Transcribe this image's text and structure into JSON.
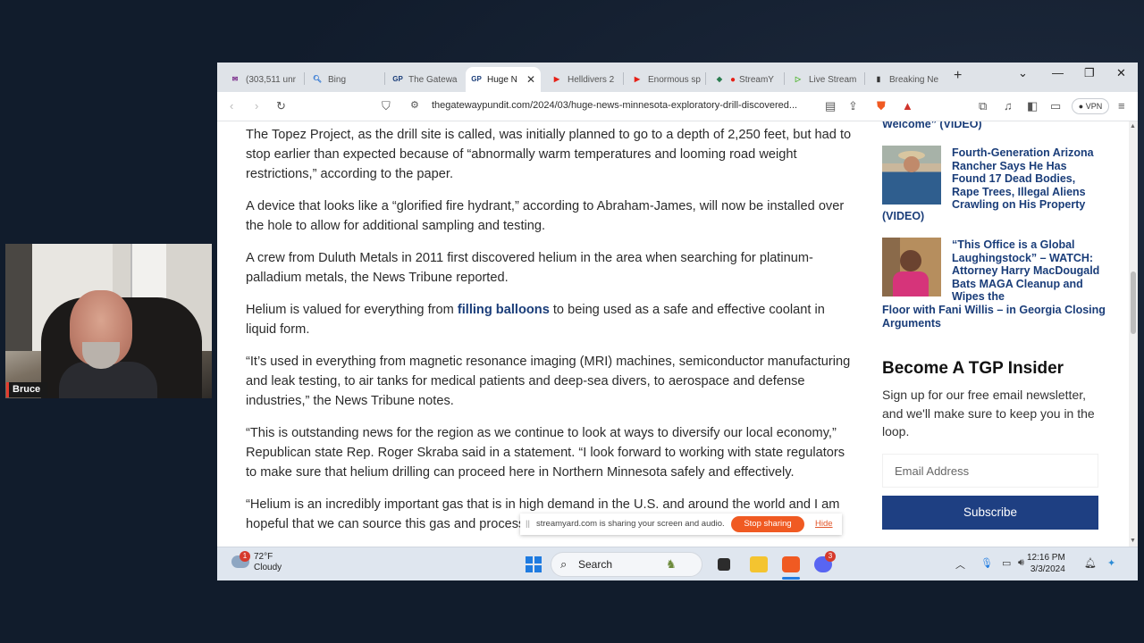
{
  "webcam": {
    "name": "Bruce"
  },
  "tabs": [
    {
      "label": "(303,511 unr",
      "icon": "mail-icon",
      "color": "#7b2d8b"
    },
    {
      "label": "Bing",
      "icon": "search-icon",
      "color": "#1b6ad1"
    },
    {
      "label": "The Gatewa",
      "icon": "gp-icon",
      "color": "#1a3d79"
    },
    {
      "label": "Huge N",
      "icon": "gp-icon",
      "color": "#1a3d79",
      "active": true
    },
    {
      "label": "Helldivers 2",
      "icon": "youtube-icon",
      "color": "#e62117"
    },
    {
      "label": "Enormous sp",
      "icon": "youtube-icon",
      "color": "#e62117"
    },
    {
      "label": "StreamY",
      "icon": "streamyard-icon",
      "color": "#2a7d4f"
    },
    {
      "label": "Live Stream",
      "icon": "rumble-icon",
      "color": "#4cb32a"
    },
    {
      "label": "Breaking Ne",
      "icon": "bookmark-icon",
      "color": "#333333"
    }
  ],
  "address": {
    "url": "thegatewaypundit.com/2024/03/huge-news-minnesota-exploratory-drill-discovered..."
  },
  "toolbar": {
    "vpn_label": "VPN"
  },
  "article": {
    "paragraphs": [
      "The Topez Project, as the drill site is called, was initially planned to go to a depth of 2,250 feet, but had to stop earlier than expected because of “abnormally warm temperatures and looming road weight restrictions,” according to the paper.",
      "A device that looks like a “glorified fire hydrant,” according to Abraham-James, will now be installed over the hole to allow for additional sampling and testing.",
      "A crew from Duluth Metals in 2011 first discovered helium in the area when searching for platinum-palladium metals, the News Tribune reported."
    ],
    "p4_before": "Helium is valued for everything from ",
    "p4_link": "filling balloons",
    "p4_after": " to being used as a safe and effective coolant in liquid form.",
    "p5": "“It’s used in everything from magnetic resonance imaging (MRI) machines, semiconductor manufacturing and leak testing, to air tanks for medical patients and deep-sea divers, to aerospace and defense industries,” the News Tribune notes.",
    "p6": "“This is outstanding news for the region as we continue to look at ways to diversify our local economy,” Republican state Rep. Roger Skraba said in a statement. “I look forward to working with state regulators to make sure that helium drilling can proceed here in Northern Minnesota safely and effectively.",
    "p7": "“Helium is an incredibly important gas that is in high demand in the U.S. and around the world and I am hopeful that we can source this gas and process it right here in the Northland in the very"
  },
  "share_banner": {
    "text": "streamyard.com is sharing your screen and audio.",
    "stop_label": "Stop sharing",
    "hide_label": "Hide"
  },
  "sidebar": {
    "partial_top": "Welcome” (VIDEO)",
    "story1_title": "Fourth-Generation Arizona Rancher Says He Has Found 17 Dead Bodies, Rape Trees, Illegal Aliens Crawling on His Property",
    "story1_suffix": "(VIDEO)",
    "story2_title": "“This Office is a Global Laughingstock” – WATCH: Attorney Harry MacDougald Bats MAGA Cleanup and Wipes the",
    "story2_suffix": "Floor with Fani Willis – in Georgia Closing Arguments",
    "insider_heading": "Become A TGP Insider",
    "insider_text": "Sign up for our free email newsletter, and we'll make sure to keep you in the loop.",
    "email_placeholder": "Email Address",
    "subscribe_label": "Subscribe"
  },
  "taskbar": {
    "weather_temp": "72°F",
    "weather_desc": "Cloudy",
    "weather_badge": "1",
    "search_label": "Search",
    "time": "12:16 PM",
    "date": "3/3/2024",
    "discord_badge": "3"
  }
}
